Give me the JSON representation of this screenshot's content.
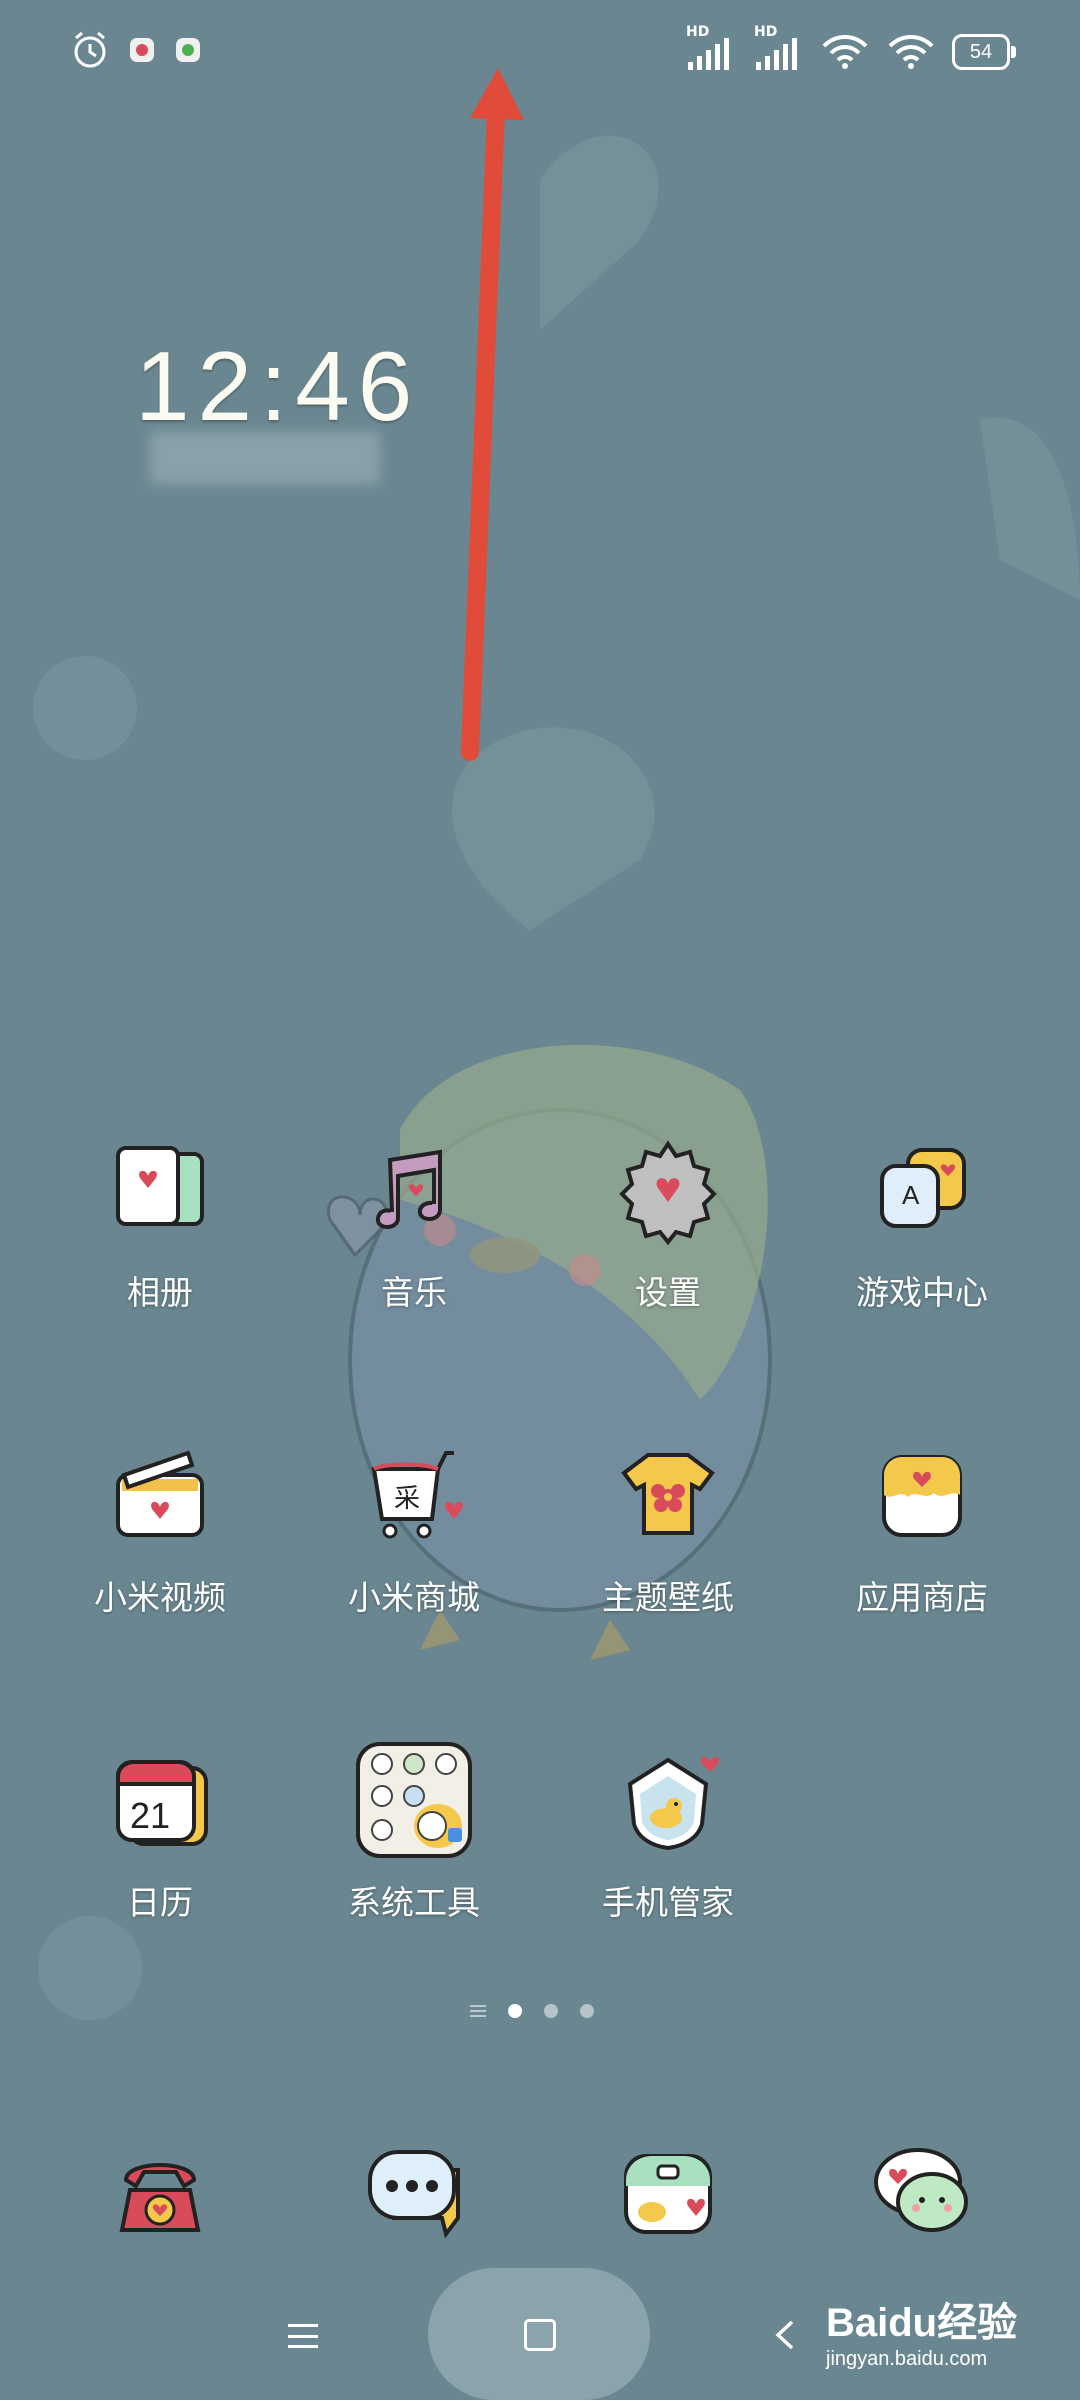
{
  "status_bar": {
    "left_icons": [
      "alarm-icon",
      "app-notification-icon",
      "app-notification-icon"
    ],
    "signal_1_label": "HD",
    "signal_2_label": "HD",
    "battery": "54"
  },
  "lockscreen": {
    "time": "12:46"
  },
  "apps": [
    {
      "label": "相册",
      "icon": "gallery-icon"
    },
    {
      "label": "音乐",
      "icon": "music-icon"
    },
    {
      "label": "设置",
      "icon": "settings-gear-icon"
    },
    {
      "label": "游戏中心",
      "icon": "game-center-icon"
    },
    {
      "label": "小米视频",
      "icon": "video-icon"
    },
    {
      "label": "小米商城",
      "icon": "shop-cart-icon"
    },
    {
      "label": "主题壁纸",
      "icon": "theme-shirt-icon"
    },
    {
      "label": "应用商店",
      "icon": "app-store-icon"
    },
    {
      "label": "日历",
      "icon": "calendar-icon"
    },
    {
      "label": "系统工具",
      "icon": "folder-icon"
    },
    {
      "label": "手机管家",
      "icon": "security-icon"
    }
  ],
  "calendar_day": "21",
  "cart_char": "采",
  "game_letter": "A",
  "page_indicator": {
    "pages": 3,
    "active": 1
  },
  "dock": [
    "phone-icon",
    "messages-icon",
    "camera-icon",
    "chat-bubble-icon"
  ],
  "watermark": {
    "brand": "Baidu经验",
    "url": "jingyan.baidu.com"
  },
  "colors": {
    "background": "#6a8791",
    "arrow": "#e14b3a",
    "accent_heart": "#d94a5a"
  }
}
